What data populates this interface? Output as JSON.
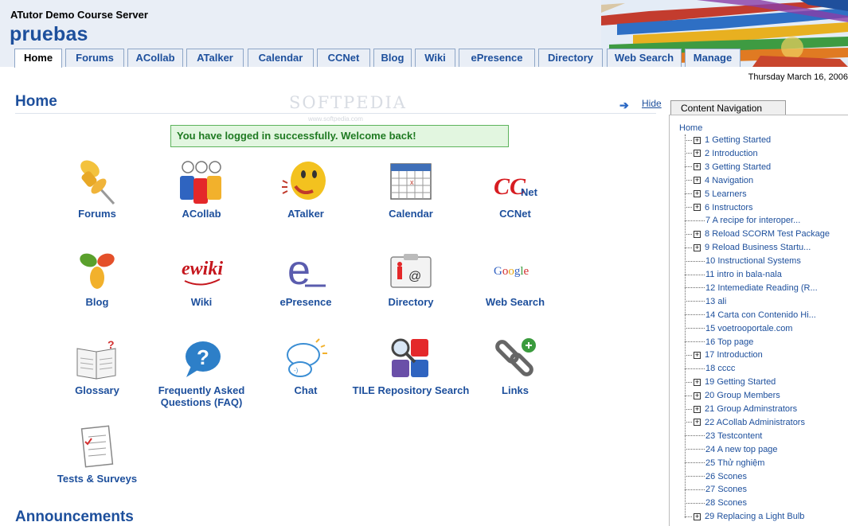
{
  "header": {
    "site_name": "ATutor Demo Course Server",
    "course_title": "pruebas",
    "date": "Thursday March 16, 2006"
  },
  "tabs": [
    {
      "label": "Home",
      "active": true
    },
    {
      "label": "Forums"
    },
    {
      "label": "ACollab"
    },
    {
      "label": "ATalker"
    },
    {
      "label": "Calendar"
    },
    {
      "label": "CCNet"
    },
    {
      "label": "Blog"
    },
    {
      "label": "Wiki"
    },
    {
      "label": "ePresence"
    },
    {
      "label": "Directory"
    },
    {
      "label": "Web Search"
    },
    {
      "label": "Manage"
    }
  ],
  "main": {
    "title": "Home",
    "watermark": "SOFTPEDIA",
    "watermark_url": "www.softpedia.com",
    "hide_label": "Hide",
    "success_message": "You have logged in successfully. Welcome back!",
    "announcements_title": "Announcements",
    "tools": [
      {
        "label": "Forums",
        "icon": "pushpin-icon"
      },
      {
        "label": "ACollab",
        "icon": "people-icon"
      },
      {
        "label": "ATalker",
        "icon": "talking-face-icon"
      },
      {
        "label": "Calendar",
        "icon": "calendar-icon"
      },
      {
        "label": "CCNet",
        "icon": "ccnet-logo-icon"
      },
      {
        "label": "Blog",
        "icon": "blog-flower-icon"
      },
      {
        "label": "Wiki",
        "icon": "ewiki-logo-icon"
      },
      {
        "label": "ePresence",
        "icon": "epresence-e-icon"
      },
      {
        "label": "Directory",
        "icon": "directory-card-icon"
      },
      {
        "label": "Web Search",
        "icon": "google-logo-icon"
      },
      {
        "label": "Glossary",
        "icon": "open-book-icon"
      },
      {
        "label": "Frequently Asked Questions (FAQ)",
        "icon": "question-bubble-icon"
      },
      {
        "label": "Chat",
        "icon": "chat-bubbles-icon"
      },
      {
        "label": "TILE Repository Search",
        "icon": "magnifier-tiles-icon"
      },
      {
        "label": "Links",
        "icon": "chain-link-icon"
      },
      {
        "label": "Tests & Surveys",
        "icon": "test-sheet-icon"
      }
    ]
  },
  "content_navigation": {
    "tab_label": "Content Navigation",
    "home_label": "Home",
    "items": [
      {
        "num": "1",
        "title": "Getting Started",
        "expandable": true
      },
      {
        "num": "2",
        "title": "Introduction",
        "expandable": true
      },
      {
        "num": "3",
        "title": "Getting Started",
        "expandable": true
      },
      {
        "num": "4",
        "title": "Navigation",
        "expandable": true
      },
      {
        "num": "5",
        "title": "Learners",
        "expandable": true
      },
      {
        "num": "6",
        "title": "Instructors",
        "expandable": true
      },
      {
        "num": "7",
        "title": "A recipe for interoper...",
        "expandable": false
      },
      {
        "num": "8",
        "title": "Reload SCORM Test Package",
        "expandable": true
      },
      {
        "num": "9",
        "title": "Reload Business Startu...",
        "expandable": true
      },
      {
        "num": "10",
        "title": "Instructional Systems",
        "expandable": false
      },
      {
        "num": "11",
        "title": "intro in bala-nala",
        "expandable": false
      },
      {
        "num": "12",
        "title": "Intemediate Reading (R...",
        "expandable": false
      },
      {
        "num": "13",
        "title": "ali",
        "expandable": false
      },
      {
        "num": "14",
        "title": "Carta con Contenido Hi...",
        "expandable": false
      },
      {
        "num": "15",
        "title": "voetrooportale.com",
        "expandable": false
      },
      {
        "num": "16",
        "title": "Top page",
        "expandable": false
      },
      {
        "num": "17",
        "title": "Introduction",
        "expandable": true
      },
      {
        "num": "18",
        "title": "cccc",
        "expandable": false
      },
      {
        "num": "19",
        "title": "Getting Started",
        "expandable": true
      },
      {
        "num": "20",
        "title": "Group Members",
        "expandable": true
      },
      {
        "num": "21",
        "title": "Group Adminstrators",
        "expandable": true
      },
      {
        "num": "22",
        "title": "ACollab Administrators",
        "expandable": true
      },
      {
        "num": "23",
        "title": "Testcontent",
        "expandable": false
      },
      {
        "num": "24",
        "title": "A new top page",
        "expandable": false
      },
      {
        "num": "25",
        "title": "Thử nghiệm",
        "expandable": false
      },
      {
        "num": "26",
        "title": "Scones",
        "expandable": false
      },
      {
        "num": "27",
        "title": "Scones",
        "expandable": false
      },
      {
        "num": "28",
        "title": "Scones",
        "expandable": false
      },
      {
        "num": "29",
        "title": "Replacing a Light Bulb",
        "expandable": true
      }
    ]
  },
  "colors": {
    "link_blue": "#1d4f9c",
    "success_bg": "#e2f6e0",
    "success_border": "#5db35c",
    "header_bg": "#e9eef6"
  }
}
